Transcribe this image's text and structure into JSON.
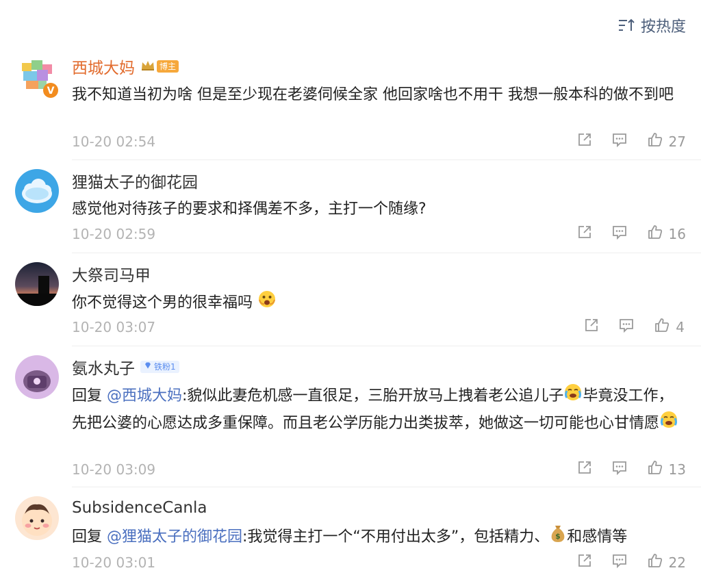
{
  "sort": {
    "label": "按热度"
  },
  "comments": [
    {
      "username": "西城大妈",
      "badge": "博主",
      "text": "我不知道当初为啥 但是至少现在老婆伺候全家 他回家啥也不用干 我想一般本科的做不到吧",
      "time": "10-20 02:54",
      "likes": "27"
    },
    {
      "username": "狸猫太子的御花园",
      "text": "感觉他对待孩子的要求和择偶差不多，主打一个随缘?",
      "time": "10-20 02:59",
      "likes": "16"
    },
    {
      "username": "大祭司马甲",
      "text": "你不觉得这个男的很幸福吗",
      "time": "10-20 03:07",
      "likes": "4"
    },
    {
      "username": "氨水丸子",
      "badge": "铁粉1",
      "reply_prefix": "回复 ",
      "mention": "@西城大妈",
      "text_a": ":貌似此妻危机感一直很足，三胎开放马上拽着老公追儿子",
      "text_b": "毕竟没工作，先把公婆的心愿达成多重保障。而且老公学历能力出类拔萃，她做这一切可能也心甘情愿",
      "time": "10-20 03:09",
      "likes": "13"
    },
    {
      "username": "SubsidenceCanla",
      "reply_prefix": "回复 ",
      "mention": "@狸猫太子的御花园",
      "text_a": ":我觉得主打一个“不用付出太多”，包括精力、",
      "text_b": "和感情等",
      "time": "10-20 03:01",
      "likes": "22"
    }
  ],
  "colors": {
    "mention": "#4a6fbf",
    "vip_name": "#e26b2d",
    "meta": "#b3b3b3"
  }
}
